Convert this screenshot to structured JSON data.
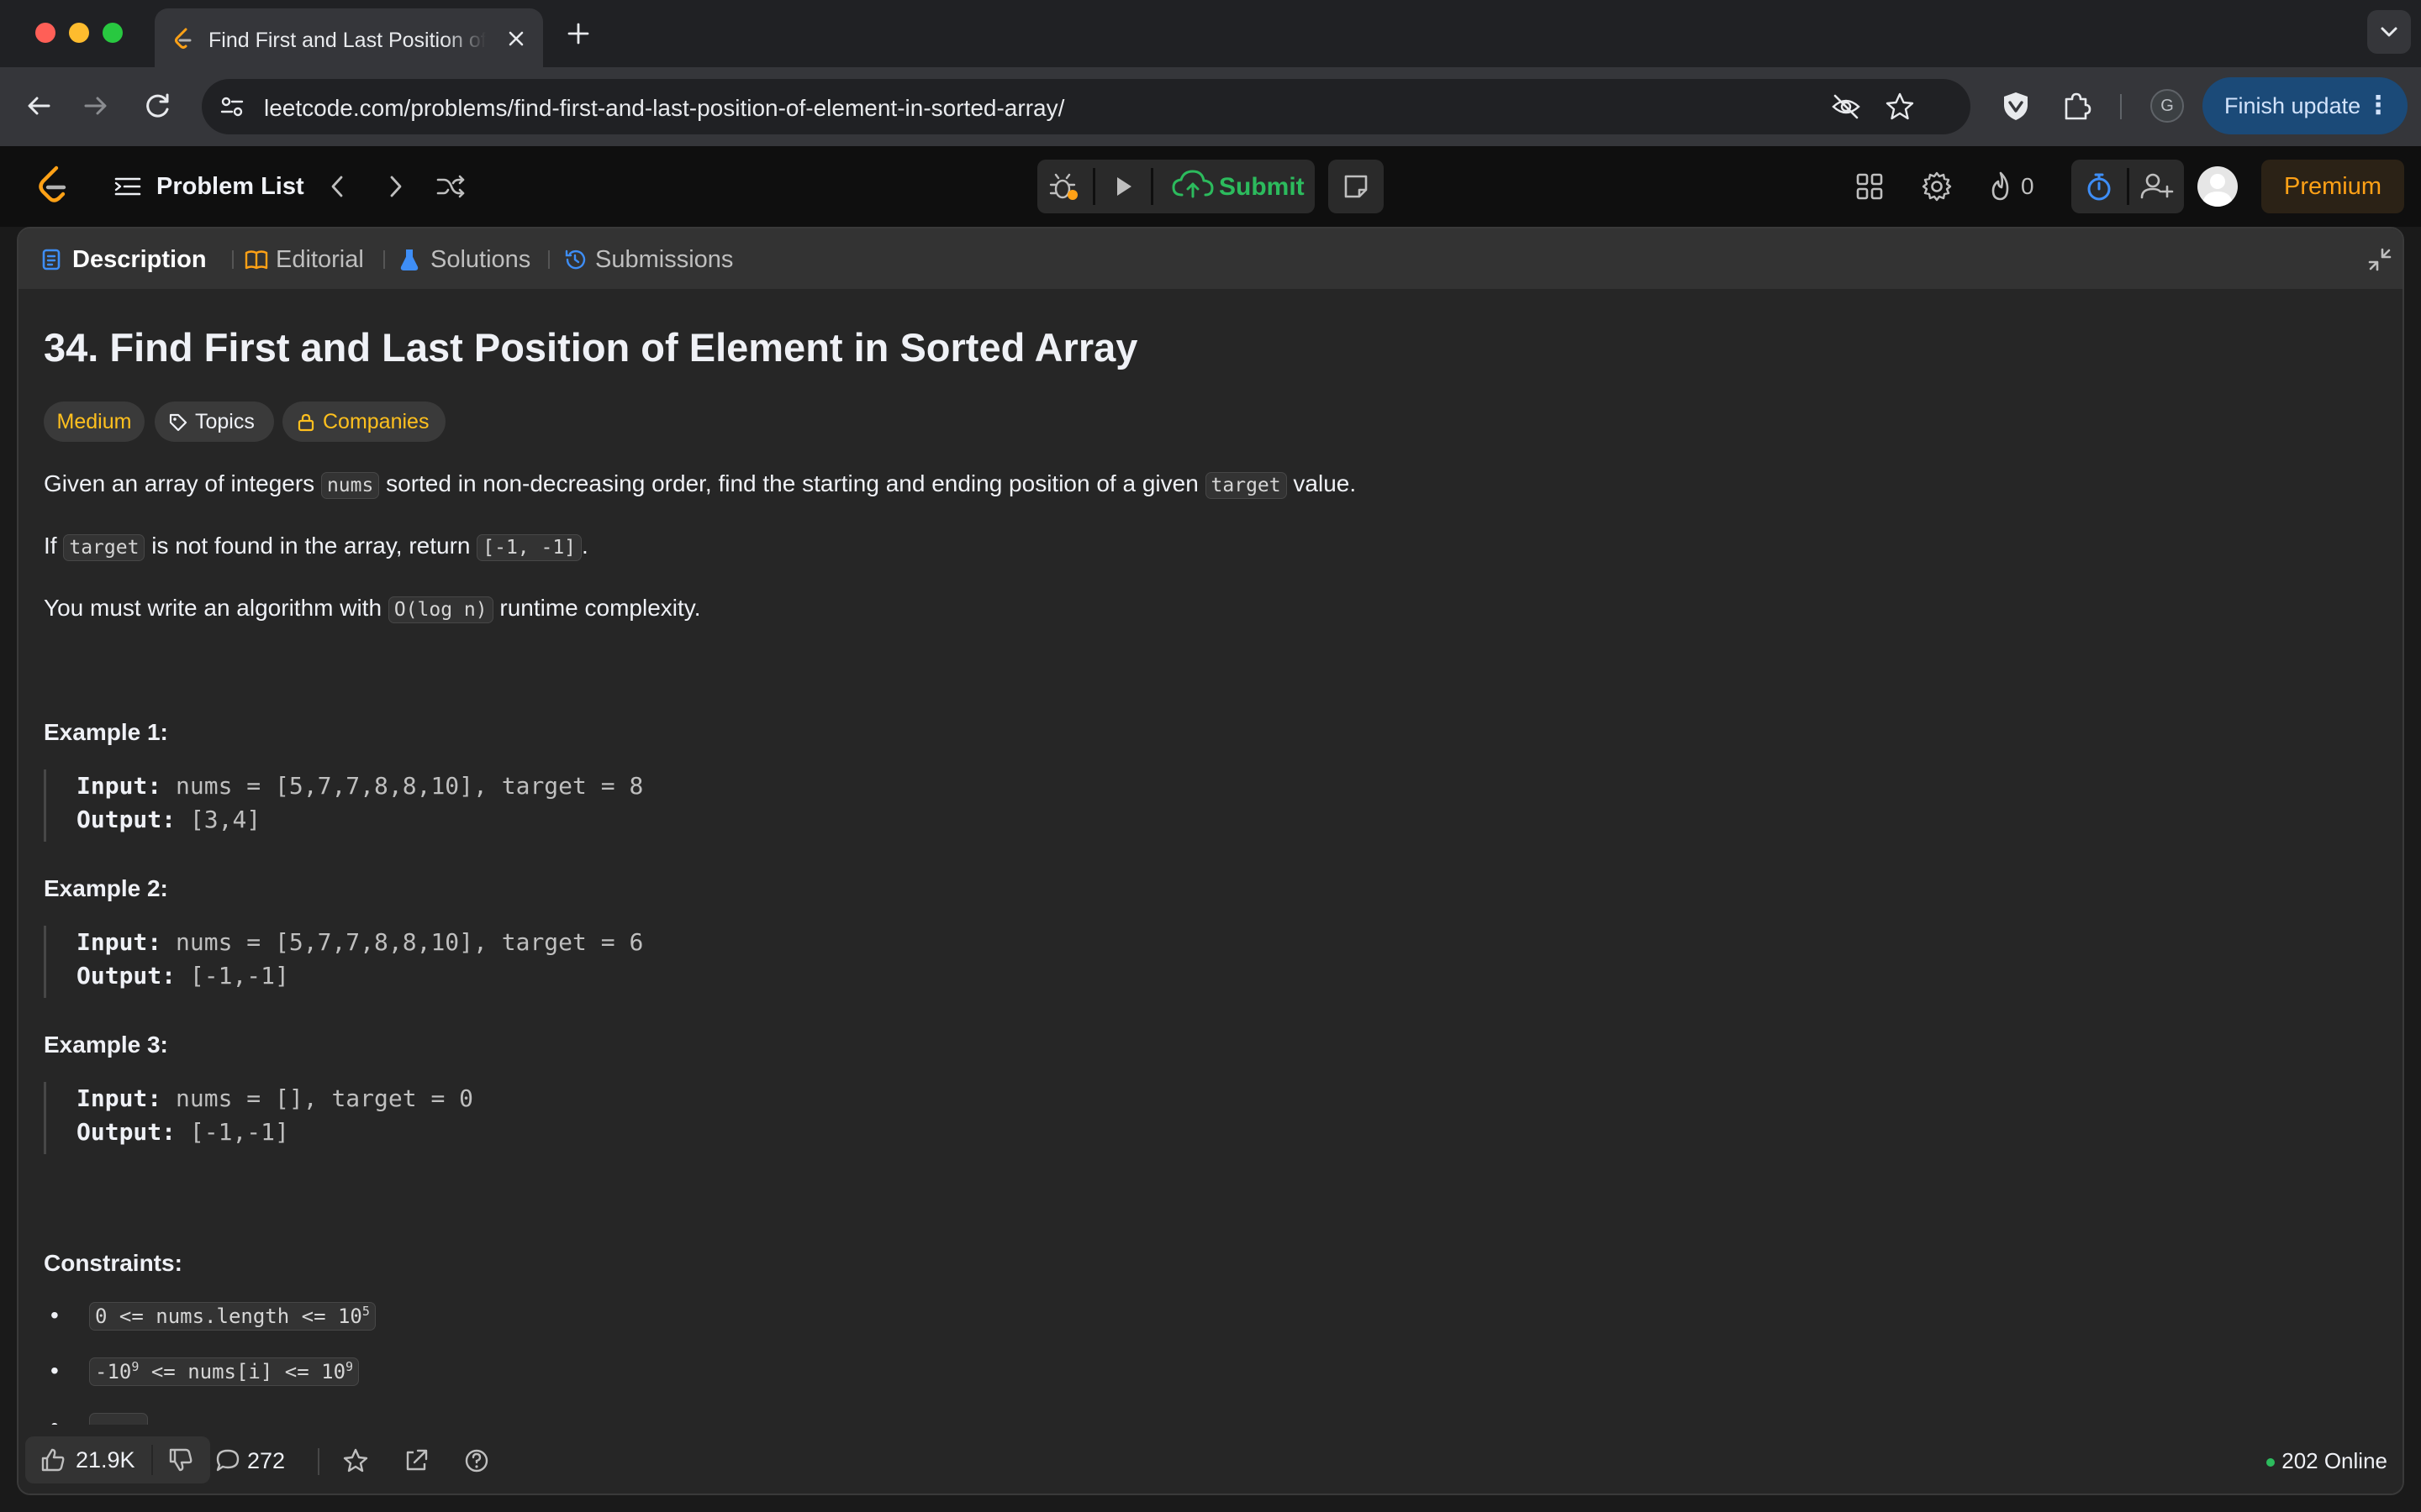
{
  "browser": {
    "tab_title": "Find First and Last Position of Element in Sorted Array - LeetCode",
    "url": "leetcode.com/problems/find-first-and-last-position-of-element-in-sorted-array/",
    "profile_initial": "G",
    "finish_update_label": "Finish update"
  },
  "nav": {
    "problem_list_label": "Problem List",
    "submit_label": "Submit",
    "streak_count": "0",
    "premium_label": "Premium"
  },
  "panel_tabs": {
    "description": "Description",
    "editorial": "Editorial",
    "solutions": "Solutions",
    "submissions": "Submissions"
  },
  "problem": {
    "title": "34. Find First and Last Position of Element in Sorted Array",
    "difficulty": "Medium",
    "topics_label": "Topics",
    "companies_label": "Companies",
    "p1_a": "Given an array of integers ",
    "p1_code1": "nums",
    "p1_b": " sorted in non-decreasing order, find the starting and ending position of a given ",
    "p1_code2": "target",
    "p1_c": " value.",
    "p2_a": "If ",
    "p2_code1": "target",
    "p2_b": " is not found in the array, return ",
    "p2_code2": "[-1, -1]",
    "p2_c": ".",
    "p3_a": "You must write an algorithm with ",
    "p3_code": "O(log n)",
    "p3_b": " runtime complexity."
  },
  "examples": [
    {
      "heading": "Example 1:",
      "input_label": "Input:",
      "input": " nums = [5,7,7,8,8,10], target = 8",
      "output_label": "Output:",
      "output": " [3,4]"
    },
    {
      "heading": "Example 2:",
      "input_label": "Input:",
      "input": " nums = [5,7,7,8,8,10], target = 6",
      "output_label": "Output:",
      "output": " [-1,-1]"
    },
    {
      "heading": "Example 3:",
      "input_label": "Input:",
      "input": " nums = [], target = 0",
      "output_label": "Output:",
      "output": " [-1,-1]"
    }
  ],
  "constraints": {
    "heading": "Constraints:",
    "c1_base": "0 <= nums.length <= 10",
    "c1_sup": "5",
    "c2_a": "-10",
    "c2_sup1": "9",
    "c2_b": " <= nums[i] <= 10",
    "c2_sup2": "9"
  },
  "footer": {
    "likes": "21.9K",
    "comments": "272",
    "online": "202 Online"
  },
  "colors": {
    "accent_orange": "#ffa116",
    "medium_yellow": "#ffc01e",
    "submit_green": "#2cbb5d",
    "panel_bg": "#262626"
  }
}
